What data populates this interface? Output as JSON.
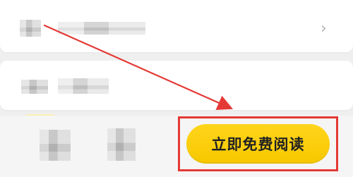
{
  "screen": {
    "chevron_symbol": "›",
    "primary_action_label": "立即免费阅读"
  },
  "ui": {
    "bottom_button": {
      "label": "立即免费阅读"
    }
  },
  "colors": {
    "highlight_box": "#e53935",
    "button_yellow": "#ffd51c",
    "tag_yellow": "#f7d94a",
    "background": "#efefef"
  },
  "icons": {
    "right_chevron": "chevron-right-icon",
    "annotation_arrow": "arrow-icon"
  }
}
